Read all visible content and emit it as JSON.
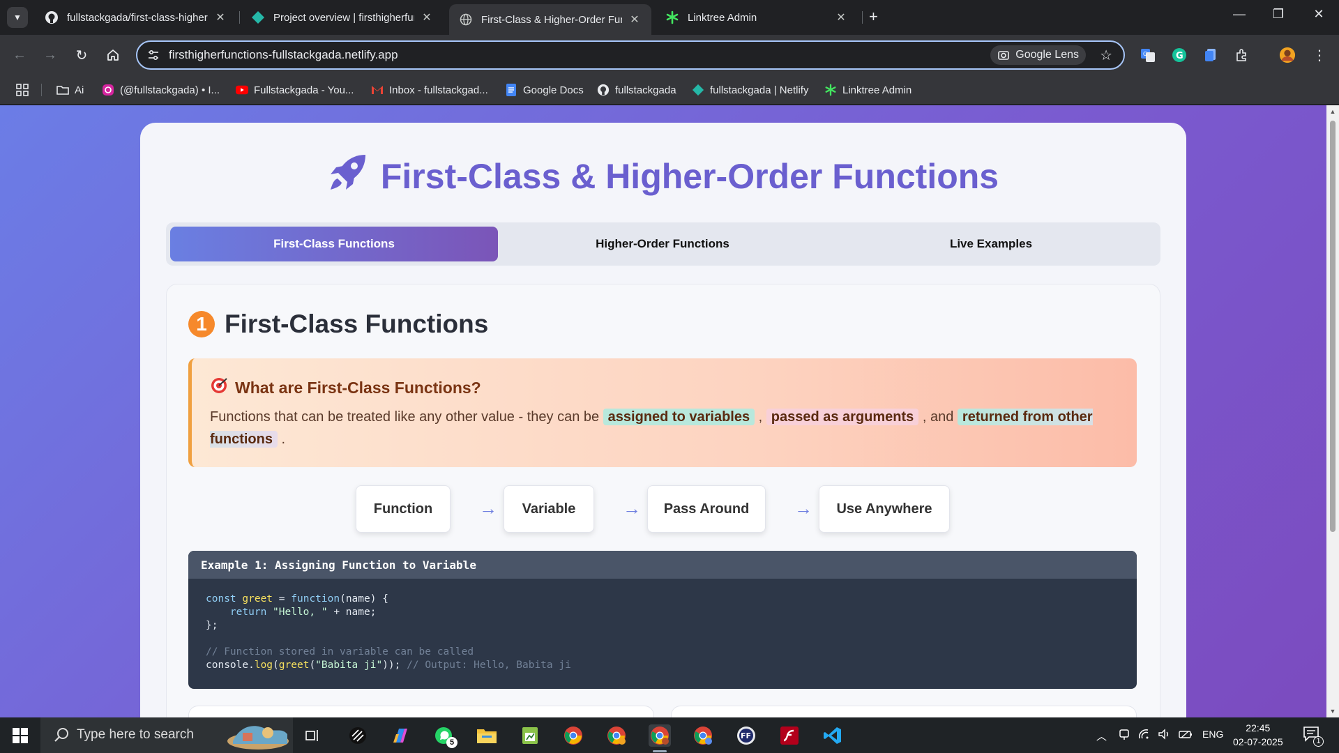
{
  "browser": {
    "tabs": [
      {
        "title": "fullstackgada/first-class-higher-",
        "icon": "github-icon"
      },
      {
        "title": "Project overview | firsthigherfun",
        "icon": "netlify-icon"
      },
      {
        "title": "First-Class & Higher-Order Func",
        "icon": "globe-icon",
        "active": true
      },
      {
        "title": "Linktree Admin",
        "icon": "linktree-icon"
      }
    ],
    "url": "firsthigherfunctions-fullstackgada.netlify.app",
    "lens_label": "Google Lens",
    "bookmarks": [
      {
        "label": "Ai",
        "icon": "folder-icon"
      },
      {
        "label": "(@fullstackgada) • I...",
        "icon": "instagram-icon"
      },
      {
        "label": "Fullstackgada - You...",
        "icon": "youtube-icon"
      },
      {
        "label": "Inbox - fullstackgad...",
        "icon": "gmail-icon"
      },
      {
        "label": "Google Docs",
        "icon": "docs-icon"
      },
      {
        "label": "fullstackgada",
        "icon": "github-icon"
      },
      {
        "label": "fullstackgada | Netlify",
        "icon": "netlify-icon"
      },
      {
        "label": "Linktree Admin",
        "icon": "linktree-icon"
      }
    ]
  },
  "page": {
    "title": "First-Class & Higher-Order Functions",
    "tabs": [
      "First-Class Functions",
      "Higher-Order Functions",
      "Live Examples"
    ],
    "active_tab": 0,
    "section": {
      "number": "1",
      "title": "First-Class Functions",
      "callout": {
        "title": "What are First-Class Functions?",
        "text_before": "Functions that can be treated like any other value - they can be ",
        "hl1": "assigned to variables",
        "sep1": " , ",
        "hl2": "passed as arguments",
        "sep2": " , and ",
        "hl3": "returned from other functions",
        "text_after": " ."
      },
      "flow": [
        "Function",
        "Variable",
        "Pass Around",
        "Use Anywhere"
      ],
      "flow_arrow": "→",
      "example": {
        "title": "Example 1: Assigning Function to Variable",
        "line1_kw": "const ",
        "line1_fn": "greet",
        "line1_mid": " = ",
        "line1_kw2": "function",
        "line1_end": "(name) {",
        "line2_kw": "    return ",
        "line2_str": "\"Hello, \"",
        "line2_end": " + name;",
        "line3": "};",
        "line5_comment": "// Function stored in variable can be called",
        "line6_a": "console.",
        "line6_fn": "log",
        "line6_b": "(",
        "line6_fn2": "greet",
        "line6_c": "(",
        "line6_str": "\"Babita ji\"",
        "line6_d": ")); ",
        "line6_comment": "// Output: Hello, Babita ji"
      }
    }
  },
  "taskbar": {
    "search_placeholder": "Type here to search",
    "whatsapp_badge": "5",
    "lang": "ENG",
    "time": "22:45",
    "date": "02-07-2025",
    "notif_count": "1"
  },
  "colors": {
    "accent": "#6a5fcf",
    "tab_active_start": "#6a7fe2",
    "tab_active_end": "#7b55b8",
    "code_bg": "#2d3748"
  }
}
